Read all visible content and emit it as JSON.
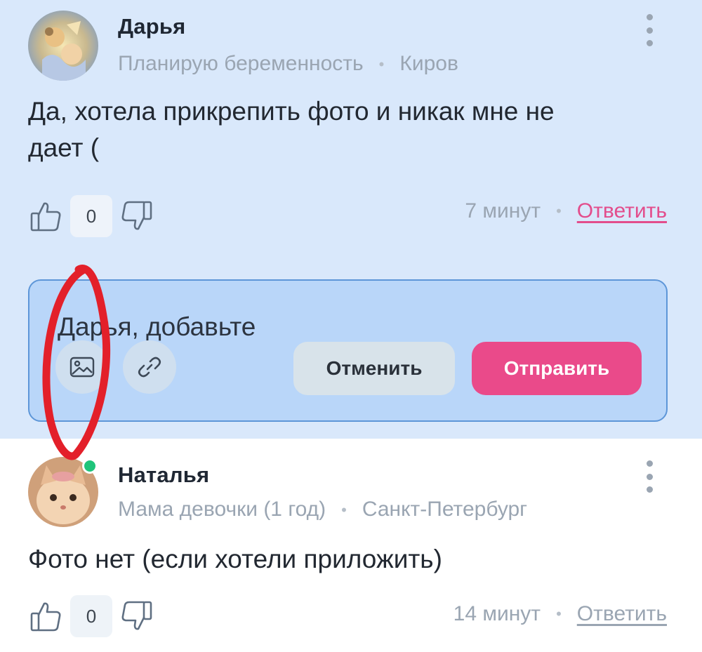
{
  "comments": [
    {
      "author": "Дарья",
      "status": "Планирую беременность",
      "city": "Киров",
      "text_line1": "Да, хотела прикрепить фото и никак мне не",
      "text_line2": "дает (",
      "votes": "0",
      "time": "7 минут",
      "reply_label": "Ответить"
    },
    {
      "author": "Наталья",
      "status": "Мама девочки (1 год)",
      "city": "Санкт-Петербург",
      "text_line1": "Фото нет (если хотели приложить)",
      "votes": "0",
      "time": "14 минут",
      "reply_label": "Ответить",
      "online": true
    }
  ],
  "reply_form": {
    "input_text": "Дарья, добавьте",
    "cancel_label": "Отменить",
    "send_label": "Отправить"
  },
  "separator": "•",
  "colors": {
    "highlight_bg": "#d9e8fb",
    "accent": "#ea4a8a",
    "annotation": "#e3202a",
    "online": "#1fc47a"
  },
  "icons": [
    "more-vertical-icon",
    "thumb-up-icon",
    "thumb-down-icon",
    "image-icon",
    "link-icon"
  ]
}
